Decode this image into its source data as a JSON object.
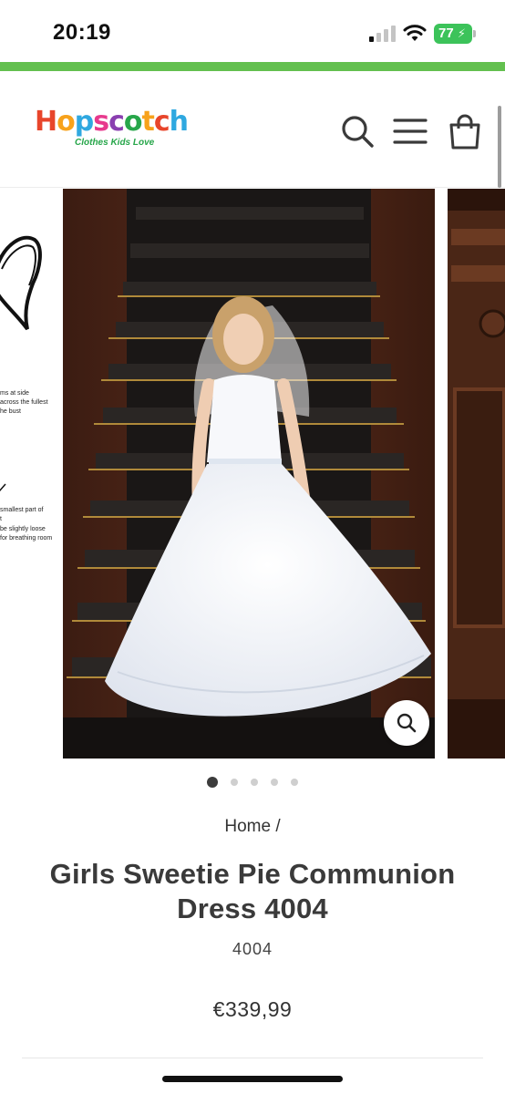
{
  "status_bar": {
    "time": "20:19",
    "battery": "77",
    "icons": [
      "cellular-signal-icon",
      "wifi-icon",
      "battery-charging-icon"
    ]
  },
  "header": {
    "logo_text": "Hopscotch",
    "logo_tagline": "Clothes Kids Love",
    "icons": [
      "search-icon",
      "menu-icon",
      "shopping-bag-icon"
    ]
  },
  "gallery": {
    "size_notes": [
      "ms at side",
      "across the fullest",
      "he bust",
      "smallest part of",
      "t",
      "be slightly loose",
      "for breathing room"
    ],
    "slide_count": 5,
    "active_slide": 1,
    "zoom_icon": "zoom-icon"
  },
  "product": {
    "breadcrumb": "Home /",
    "title": "Girls Sweetie Pie Communion Dress 4004",
    "sku": "4004",
    "price": "€339,99"
  },
  "colors": {
    "accent_green": "#63c04f",
    "battery_green": "#3cc35a",
    "text_dark": "#3a3a3a"
  }
}
